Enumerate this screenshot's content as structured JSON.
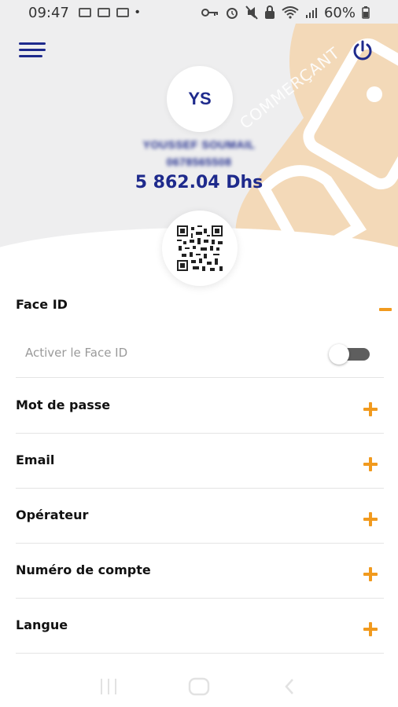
{
  "status_bar": {
    "time": "09:47",
    "battery": "60%"
  },
  "profile": {
    "initials": "YS",
    "name": "YOUSSEF SOUMAIL",
    "phone": "0678565508",
    "balance": "5 862.04 Dhs",
    "watermark": "COMMERÇANT"
  },
  "face_id": {
    "title": "Face ID",
    "option_label": "Activer le Face ID",
    "enabled": false
  },
  "settings": [
    {
      "label": "Mot de passe"
    },
    {
      "label": "Email"
    },
    {
      "label": "Opérateur"
    },
    {
      "label": "Numéro de compte"
    },
    {
      "label": "Langue"
    }
  ],
  "colors": {
    "brand_blue": "#1e2a8c",
    "accent_orange": "#f19a1e",
    "watermark_tan": "#f3d9b8"
  },
  "icons": {
    "menu": "hamburger-icon",
    "power": "power-icon",
    "qr": "qr-code-icon",
    "expand": "plus-icon",
    "collapse": "minus-icon"
  }
}
